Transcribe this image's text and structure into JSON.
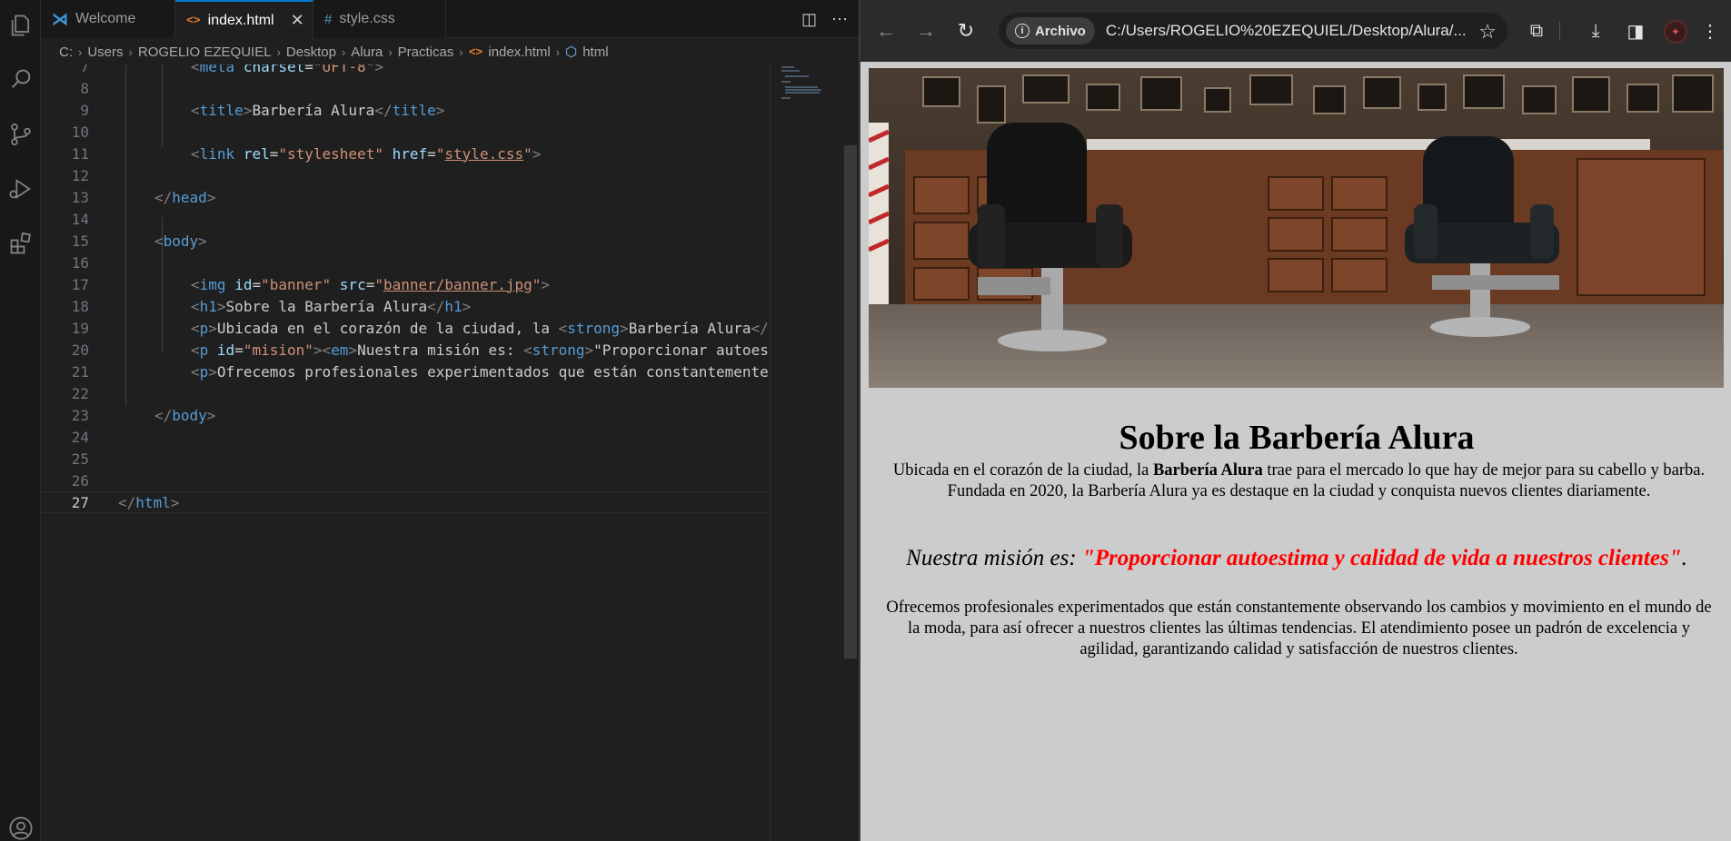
{
  "vscode": {
    "tabs": [
      {
        "label": "Welcome",
        "icon": "vscode-icon"
      },
      {
        "label": "index.html",
        "icon": "html-file-icon",
        "active": true
      },
      {
        "label": "style.css",
        "icon": "css-file-icon"
      }
    ],
    "breadcrumb": [
      "C:",
      "Users",
      "ROGELIO EZEQUIEL",
      "Desktop",
      "Alura",
      "Practicas",
      "index.html",
      "html"
    ],
    "lines": [
      {
        "n": "7"
      },
      {
        "n": "8"
      },
      {
        "n": "9"
      },
      {
        "n": "10"
      },
      {
        "n": "11"
      },
      {
        "n": "12"
      },
      {
        "n": "13"
      },
      {
        "n": "14"
      },
      {
        "n": "15"
      },
      {
        "n": "16"
      },
      {
        "n": "17"
      },
      {
        "n": "18"
      },
      {
        "n": "19"
      },
      {
        "n": "20"
      },
      {
        "n": "21"
      },
      {
        "n": "22"
      },
      {
        "n": "23"
      },
      {
        "n": "24"
      },
      {
        "n": "25"
      },
      {
        "n": "26"
      },
      {
        "n": "27"
      }
    ],
    "code": {
      "l7_attr": "charset",
      "l7_val": "\"UFT-8\"",
      "l9_text": "Barbería Alura",
      "l11_rel": "\"stylesheet\"",
      "l11_href": "style.css",
      "l17_id": "\"banner\"",
      "l17_src": "banner/banner.jpg",
      "l18_text": "Sobre la Barbería Alura",
      "l19_text": "Ubicada en el corazón de la ciudad, la ",
      "l19_strong": "Barbería Alura",
      "l20_id": "\"mision\"",
      "l20_text": "Nuestra misión es: ",
      "l20_strong": "\"Proporcionar autoest",
      "l21_text": "Ofrecemos profesionales experimentados que están constantemente"
    }
  },
  "browser": {
    "secure_chip": "Archivo",
    "url": "C:/Users/ROGELIO%20EZEQUIEL/Desktop/Alura/...",
    "page": {
      "h1": "Sobre la Barbería Alura",
      "p1_before": "Ubicada en el corazón de la ciudad, la ",
      "p1_strong": "Barbería Alura",
      "p1_after": " trae para el mercado lo que hay de mejor para su cabello y barba. Fundada en 2020, la Barbería Alura ya es destaque en la ciudad y conquista nuevos clientes diariamente.",
      "mision_lead": "Nuestra misión es: ",
      "mision_strong": "\"Proporcionar autoestima y calidad de vida a nuestros clientes\"",
      "mision_end": ".",
      "p3": "Ofrecemos profesionales experimentados que están constantemente observando los cambios y movimiento en el mundo de la moda, para así ofrecer a nuestros clientes las últimas tendencias. El atendimiento posee un padrón de excelencia y agilidad, garantizando calidad y satisfacción de nuestros clientes."
    }
  }
}
